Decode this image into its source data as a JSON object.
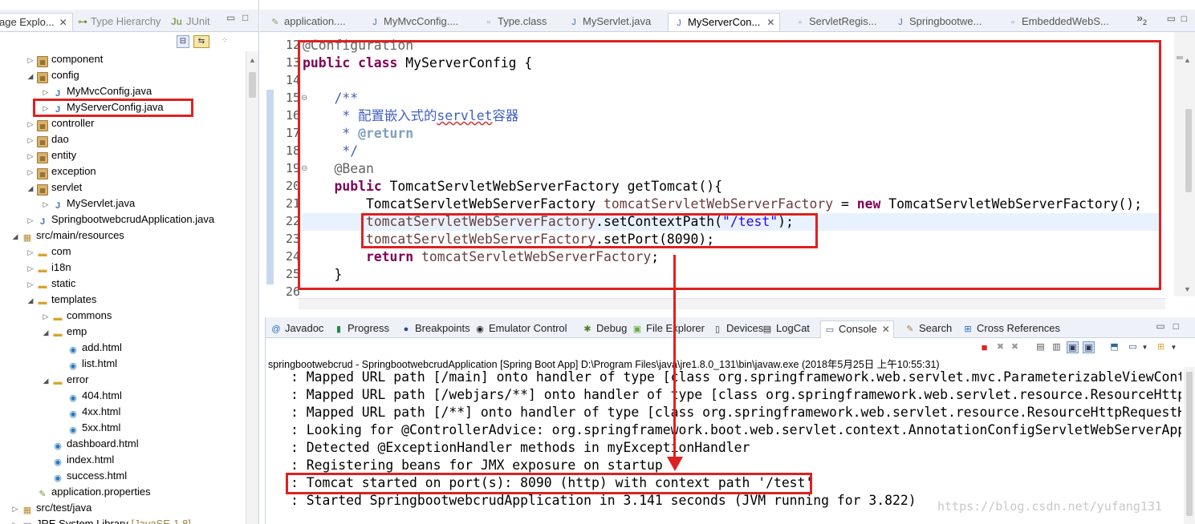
{
  "left": {
    "tabs": [
      {
        "label": "age Explo...",
        "close": "✕",
        "icon": "package-explorer"
      },
      {
        "label": "Type Hierarchy",
        "icon": "type-hierarchy"
      },
      {
        "label": "JUnit",
        "icon_text": "Ju"
      }
    ],
    "controls": [
      "▭",
      "□"
    ],
    "tree": [
      {
        "label": "component",
        "type": "package",
        "expander": "▷"
      },
      {
        "label": "config",
        "type": "package",
        "expander": "◢"
      },
      {
        "label": "MyMvcConfig.java",
        "type": "java",
        "expander": "▷"
      },
      {
        "label": "MyServerConfig.java",
        "type": "java",
        "expander": "▷",
        "highlighted": true
      },
      {
        "label": "controller",
        "type": "package",
        "expander": "▷"
      },
      {
        "label": "dao",
        "type": "package",
        "expander": "▷"
      },
      {
        "label": "entity",
        "type": "package",
        "expander": "▷"
      },
      {
        "label": "exception",
        "type": "package",
        "expander": "▷"
      },
      {
        "label": "servlet",
        "type": "package",
        "expander": "◢"
      },
      {
        "label": "MyServlet.java",
        "type": "java",
        "expander": "▷"
      },
      {
        "label": "SpringbootwebcrudApplication.java",
        "type": "java",
        "expander": "▷"
      },
      {
        "label": "src/main/resources",
        "type": "source",
        "expander": "◢"
      },
      {
        "label": "com",
        "type": "folder",
        "expander": "▷"
      },
      {
        "label": "i18n",
        "type": "folder",
        "expander": "▷"
      },
      {
        "label": "static",
        "type": "folder",
        "expander": "▷"
      },
      {
        "label": "templates",
        "type": "folder",
        "expander": "◢"
      },
      {
        "label": "commons",
        "type": "folder",
        "expander": "▷"
      },
      {
        "label": "emp",
        "type": "folder",
        "expander": "◢"
      },
      {
        "label": "add.html",
        "type": "html",
        "expander": ""
      },
      {
        "label": "list.html",
        "type": "html",
        "expander": ""
      },
      {
        "label": "error",
        "type": "folder",
        "expander": "◢"
      },
      {
        "label": "404.html",
        "type": "html",
        "expander": ""
      },
      {
        "label": "4xx.html",
        "type": "html",
        "expander": ""
      },
      {
        "label": "5xx.html",
        "type": "html",
        "expander": ""
      },
      {
        "label": "dashboard.html",
        "type": "html",
        "expander": ""
      },
      {
        "label": "index.html",
        "type": "html",
        "expander": ""
      },
      {
        "label": "success.html",
        "type": "html",
        "expander": ""
      },
      {
        "label": "application.properties",
        "type": "properties",
        "expander": ""
      },
      {
        "label": "src/test/java",
        "type": "source",
        "expander": "▷"
      },
      {
        "label": "JRE System Library",
        "suffix": "[JavaSE-1.8]",
        "type": "library",
        "expander": "▷"
      }
    ]
  },
  "editor": {
    "tabs": [
      {
        "label": "application....",
        "icon": "properties-file"
      },
      {
        "label": "MyMvcConfig....",
        "icon": "java-file"
      },
      {
        "label": "Type.class",
        "icon": "class-file"
      },
      {
        "label": "MyServlet.java",
        "icon": "java-file"
      },
      {
        "label": "MyServerCon...",
        "icon": "java-file",
        "active": true,
        "close": "✕"
      },
      {
        "label": "ServletRegis...",
        "icon": "class-file"
      },
      {
        "label": "Springbootwe...",
        "icon": "java-file"
      },
      {
        "label": "EmbeddedWebS...",
        "icon": "class-file"
      }
    ],
    "overflow": "»",
    "overflow_count": "2",
    "controls": [
      "▭",
      "□"
    ],
    "line_numbers": [
      "12",
      "13",
      "14",
      "15",
      "16",
      "17",
      "18",
      "19",
      "20",
      "21",
      "22",
      "23",
      "24",
      "25",
      "26"
    ],
    "folded_lines": [
      "15",
      "19"
    ],
    "code": [
      [
        {
          "t": "@Configuration",
          "c": "an"
        }
      ],
      [
        {
          "t": "public class ",
          "c": "kw"
        },
        {
          "t": "MyServerConfig {"
        }
      ],
      [],
      [
        {
          "t": "    /**",
          "c": "cm"
        }
      ],
      [
        {
          "t": "     * 配置嵌入式的",
          "c": "cm"
        },
        {
          "t": "servlet",
          "c": "cm squig"
        },
        {
          "t": "容器",
          "c": "cm"
        }
      ],
      [
        {
          "t": "     * ",
          "c": "cm"
        },
        {
          "t": "@return",
          "c": "tag"
        }
      ],
      [
        {
          "t": "     */",
          "c": "cm"
        }
      ],
      [
        {
          "t": "    @Bean",
          "c": "an"
        }
      ],
      [
        {
          "t": "    "
        },
        {
          "t": "public ",
          "c": "kw"
        },
        {
          "t": "TomcatServletWebServerFactory getTomcat(){"
        }
      ],
      [
        {
          "t": "        TomcatServletWebServerFactory "
        },
        {
          "t": "tomcatServletWebServerFactory",
          "c": "fld"
        },
        {
          "t": " = "
        },
        {
          "t": "new ",
          "c": "kw"
        },
        {
          "t": "TomcatServletWebServerFactory();"
        }
      ],
      [
        {
          "t": "        "
        },
        {
          "t": "tomcatServletWebServerFactory",
          "c": "fld"
        },
        {
          "t": ".setContextPath("
        },
        {
          "t": "\"/test\"",
          "c": "str"
        },
        {
          "t": ");"
        }
      ],
      [
        {
          "t": "        "
        },
        {
          "t": "tomcatServletWebServerFactory",
          "c": "fld"
        },
        {
          "t": ".setPort(8090);"
        }
      ],
      [
        {
          "t": "        "
        },
        {
          "t": "return ",
          "c": "kw"
        },
        {
          "t": "tomcatServletWebServerFactory",
          "c": "fld"
        },
        {
          "t": ";"
        }
      ],
      [
        {
          "t": "    }"
        }
      ],
      []
    ]
  },
  "console": {
    "tabs": [
      {
        "label": "Javadoc",
        "icon": "@"
      },
      {
        "label": "Progress",
        "icon": "▮"
      },
      {
        "label": "Breakpoints",
        "icon": "●"
      },
      {
        "label": "Emulator Control",
        "icon": "◉"
      },
      {
        "label": "Debug",
        "icon": "✱"
      },
      {
        "label": "File Explorer",
        "icon": "▣"
      },
      {
        "label": "Devices",
        "icon": "▯"
      },
      {
        "label": "LogCat",
        "icon": "▤"
      },
      {
        "label": "Console",
        "icon": "▭",
        "active": true,
        "close": "✕"
      },
      {
        "label": "Search",
        "icon": "✎"
      },
      {
        "label": "Cross References",
        "icon": "⊞"
      }
    ],
    "controls": [
      "▭",
      "□"
    ],
    "launch": "springbootwebcrud - SpringbootwebcrudApplication [Spring Boot App] D:\\Program Files\\java\\jre1.8.0_131\\bin\\javaw.exe (2018年5月25日 上午10:55:31)",
    "lines": [
      ": Mapped URL path [/main] onto handler of type [class org.springframework.web.servlet.mvc.ParameterizableViewController]",
      ": Mapped URL path [/webjars/**] onto handler of type [class org.springframework.web.servlet.resource.ResourceHttpRequestHandler]",
      ": Mapped URL path [/**] onto handler of type [class org.springframework.web.servlet.resource.ResourceHttpRequestHandler]",
      ": Looking for @ControllerAdvice: org.springframework.boot.web.servlet.context.AnnotationConfigServletWebServerApplicationContext",
      ": Detected @ExceptionHandler methods in myExceptionHandler",
      ": Registering beans for JMX exposure on startup",
      ": Tomcat started on port(s): 8090 (http) with context path '/test'",
      ": Started SpringbootwebcrudApplication in 3.141 seconds (JVM running for 3.822)"
    ]
  },
  "watermark": "https://blog.csdn.net/yufang131",
  "colors": {
    "annotation_red": "#e02020",
    "keyword": "#7f0055",
    "comment": "#3f5fbf",
    "string": "#2a00ff"
  }
}
